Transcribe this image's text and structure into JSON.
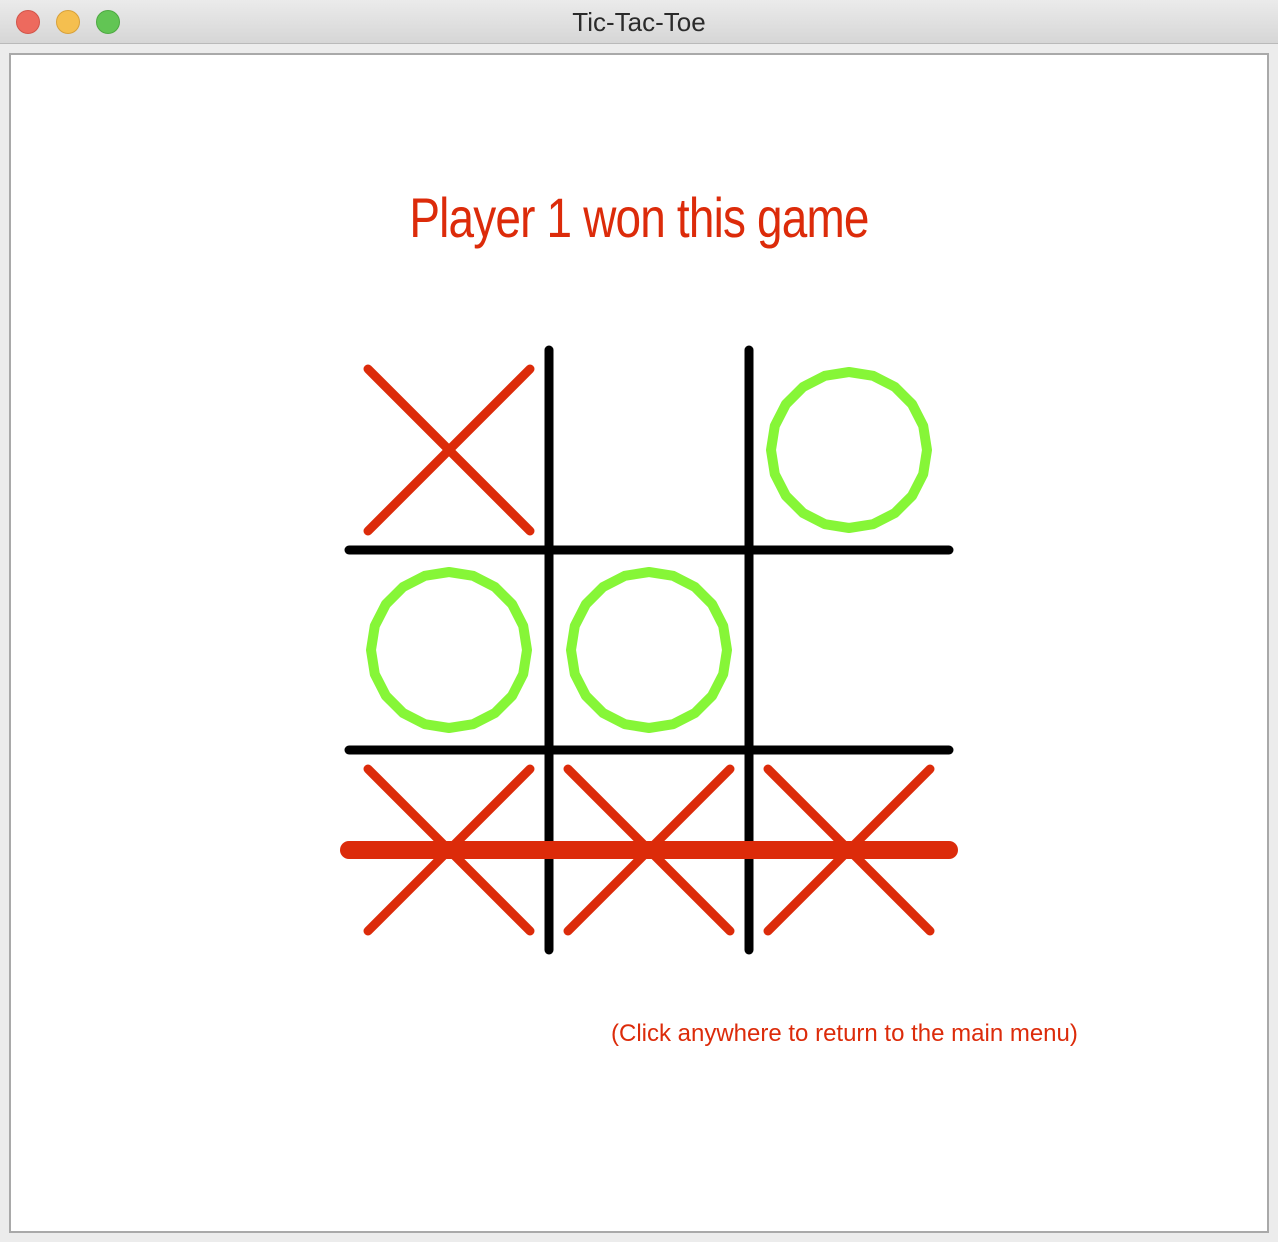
{
  "window": {
    "title": "Tic-Tac-Toe"
  },
  "game": {
    "status_message": "Player 1 won this game",
    "hint": "(Click anywhere to return to the main menu)",
    "board": [
      [
        "X",
        "",
        "O"
      ],
      [
        "O",
        "O",
        ""
      ],
      [
        "X",
        "X",
        "X"
      ]
    ],
    "winning_line": "row-3",
    "colors": {
      "x_mark": "#dc2b0a",
      "o_mark": "#86f637",
      "grid": "#000000",
      "win_line": "#dc2b0a",
      "text": "#dc2b0a"
    },
    "icons": {
      "x": "cross-icon",
      "o": "circle-icon"
    }
  }
}
